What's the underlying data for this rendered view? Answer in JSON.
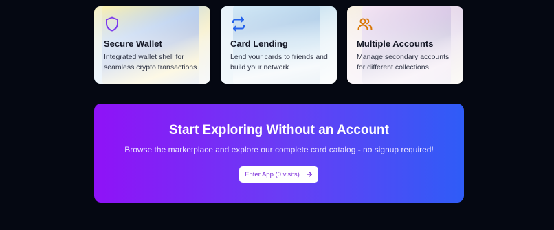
{
  "features": [
    {
      "title": "Secure Wallet",
      "description": "Integrated wallet shell for seamless crypto transactions",
      "icon": "shield-icon",
      "icon_color": "#7c3aed"
    },
    {
      "title": "Card Lending",
      "description": "Lend your cards to friends and build your network",
      "icon": "repeat-arrows-icon",
      "icon_color": "#2563eb"
    },
    {
      "title": "Multiple Accounts",
      "description": "Manage secondary accounts for different collections",
      "icon": "users-icon",
      "icon_color": "#d97706"
    }
  ],
  "cta": {
    "title": "Start Exploring Without an Account",
    "subtitle": "Browse the marketplace and explore our complete card catalog - no signup required!",
    "button_label": "Enter App (0 visits)",
    "button_icon": "arrow-right-icon",
    "gradient_start": "#8f12f7",
    "gradient_end": "#2f5cf7"
  },
  "page_background": "#050812"
}
